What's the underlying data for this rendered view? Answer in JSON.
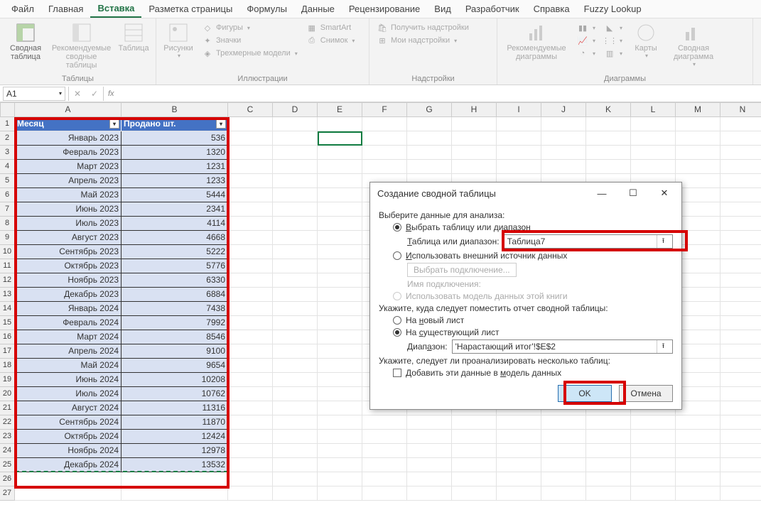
{
  "menu": [
    "Файл",
    "Главная",
    "Вставка",
    "Разметка страницы",
    "Формулы",
    "Данные",
    "Рецензирование",
    "Вид",
    "Разработчик",
    "Справка",
    "Fuzzy Lookup"
  ],
  "active_menu_index": 2,
  "ribbon": {
    "groups": [
      {
        "label": "Таблицы",
        "buttons": [
          {
            "label": "Сводная таблица",
            "icon": "pivot-table-icon",
            "color": "#666"
          },
          {
            "label": "Рекомендуемые сводные таблицы",
            "icon": "recommended-pivot-icon",
            "color": "#aaa"
          },
          {
            "label": "Таблица",
            "icon": "table-icon",
            "color": "#aaa"
          }
        ]
      },
      {
        "label": "Иллюстрации",
        "buttons": [
          {
            "label": "Рисунки",
            "icon": "pictures-icon",
            "color": "#aaa"
          }
        ],
        "small": [
          {
            "label": "Фигуры",
            "icon": "shapes-icon"
          },
          {
            "label": "Значки",
            "icon": "icons-icon"
          },
          {
            "label": "Трехмерные модели",
            "icon": "3d-icon"
          }
        ],
        "small2": [
          {
            "label": "SmartArt",
            "icon": "smartart-icon"
          },
          {
            "label": "Снимок",
            "icon": "screenshot-icon"
          }
        ]
      },
      {
        "label": "Надстройки",
        "small": [
          {
            "label": "Получить надстройки",
            "icon": "get-addins-icon"
          },
          {
            "label": "Мои надстройки",
            "icon": "my-addins-icon"
          }
        ]
      },
      {
        "label": "Диаграммы",
        "buttons": [
          {
            "label": "Рекомендуемые диаграммы",
            "icon": "recommended-charts-icon",
            "color": "#aaa"
          }
        ],
        "chartbtns": true,
        "extra": [
          {
            "label": "Карты",
            "icon": "maps-icon"
          },
          {
            "label": "Сводная диаграмма",
            "icon": "pivot-chart-icon"
          }
        ]
      }
    ]
  },
  "name_box": "A1",
  "columns": [
    "A",
    "B",
    "C",
    "D",
    "E",
    "F",
    "G",
    "H",
    "I",
    "J",
    "K",
    "L",
    "M",
    "N"
  ],
  "table": {
    "headers": [
      "Месяц",
      "Продано шт."
    ],
    "rows": [
      [
        "Январь 2023",
        "536"
      ],
      [
        "Февраль 2023",
        "1320"
      ],
      [
        "Март 2023",
        "1231"
      ],
      [
        "Апрель 2023",
        "1233"
      ],
      [
        "Май 2023",
        "5444"
      ],
      [
        "Июнь 2023",
        "2341"
      ],
      [
        "Июль 2023",
        "4114"
      ],
      [
        "Август 2023",
        "4668"
      ],
      [
        "Сентябрь 2023",
        "5222"
      ],
      [
        "Октябрь 2023",
        "5776"
      ],
      [
        "Ноябрь 2023",
        "6330"
      ],
      [
        "Декабрь 2023",
        "6884"
      ],
      [
        "Январь 2024",
        "7438"
      ],
      [
        "Февраль 2024",
        "7992"
      ],
      [
        "Март 2024",
        "8546"
      ],
      [
        "Апрель 2024",
        "9100"
      ],
      [
        "Май 2024",
        "9654"
      ],
      [
        "Июнь 2024",
        "10208"
      ],
      [
        "Июль 2024",
        "10762"
      ],
      [
        "Август 2024",
        "11316"
      ],
      [
        "Сентябрь 2024",
        "11870"
      ],
      [
        "Октябрь 2024",
        "12424"
      ],
      [
        "Ноябрь 2024",
        "12978"
      ],
      [
        "Декабрь 2024",
        "13532"
      ]
    ]
  },
  "dialog": {
    "title": "Создание сводной таблицы",
    "section1": "Выберите данные для анализа:",
    "opt_select": "Выбрать таблицу или диапазон",
    "table_label": "Таблица или диапазон:",
    "table_value": "Таблица7",
    "opt_external": "Использовать внешний источник данных",
    "choose_connection": "Выбрать подключение...",
    "connection_name": "Имя подключения:",
    "opt_model": "Использовать модель данных этой книги",
    "section2": "Укажите, куда следует поместить отчет сводной таблицы:",
    "opt_newsheet": "На новый лист",
    "opt_existing": "На существующий лист",
    "range_label": "Диапазон:",
    "range_value": "'Нарастающий итог'!$E$2",
    "section3": "Укажите, следует ли проанализировать несколько таблиц:",
    "add_model": "Добавить эти данные в модель данных",
    "ok": "OK",
    "cancel": "Отмена"
  }
}
